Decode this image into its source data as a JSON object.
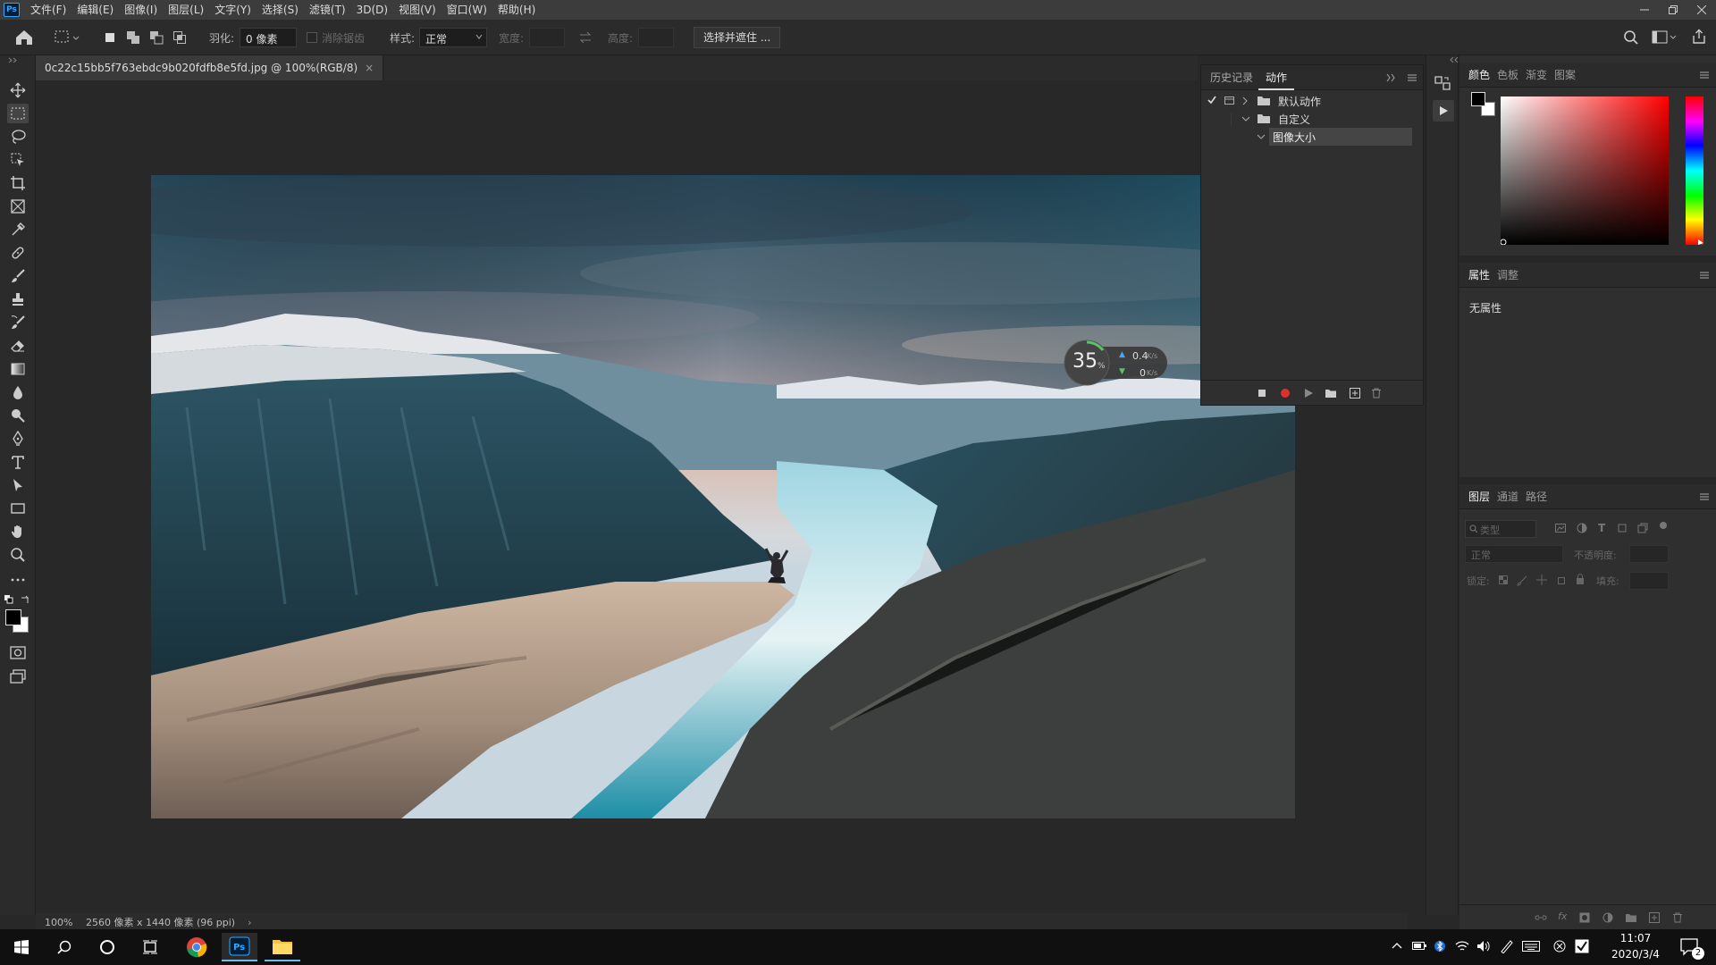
{
  "app": {
    "logo": "Ps"
  },
  "menu": [
    "文件(F)",
    "编辑(E)",
    "图像(I)",
    "图层(L)",
    "文字(Y)",
    "选择(S)",
    "滤镜(T)",
    "3D(D)",
    "视图(V)",
    "窗口(W)",
    "帮助(H)"
  ],
  "options": {
    "feather_label": "羽化:",
    "feather_value": "0 像素",
    "antialias_label": "消除锯齿",
    "style_label": "样式:",
    "style_value": "正常",
    "width_label": "宽度:",
    "height_label": "高度:",
    "select_mask_button": "选择并遮住 ..."
  },
  "document": {
    "tab_title": "0c22c15bb5f763ebdc9b020fdfb8e5fd.jpg @ 100%(RGB/8)",
    "close": "×"
  },
  "status": {
    "zoom": "100%",
    "dimensions": "2560 像素 x 1440 像素 (96 ppi)",
    "arrow": "›"
  },
  "actions_panel": {
    "tabs": [
      "历史记录",
      "动作"
    ],
    "items": [
      {
        "label": "默认动作",
        "expanded": false
      },
      {
        "label": "自定义",
        "expanded": true
      },
      {
        "label": "图像大小",
        "selected": true
      }
    ]
  },
  "net_monitor": {
    "percent": "35",
    "percent_unit": "%",
    "up_value": "0.4",
    "up_unit": "K/s",
    "down_value": "0",
    "down_unit": "K/s"
  },
  "color_panel": {
    "tabs": [
      "颜色",
      "色板",
      "渐变",
      "图案"
    ],
    "foreground": "#000000",
    "background": "#ffffff"
  },
  "properties_panel": {
    "tabs": [
      "属性",
      "调整"
    ],
    "content": "无属性"
  },
  "layers_panel": {
    "tabs": [
      "图层",
      "通道",
      "路径"
    ],
    "search_placeholder": "类型",
    "blend_mode": "正常",
    "opacity_label": "不透明度:",
    "lock_label": "锁定:",
    "fill_label": "填充:"
  },
  "taskbar": {
    "time": "11:07",
    "date": "2020/3/4",
    "notification_count": "2"
  },
  "colors": {
    "accent": "#31a8ff",
    "record": "#e0302a",
    "chrome": "#2b2b2b"
  }
}
